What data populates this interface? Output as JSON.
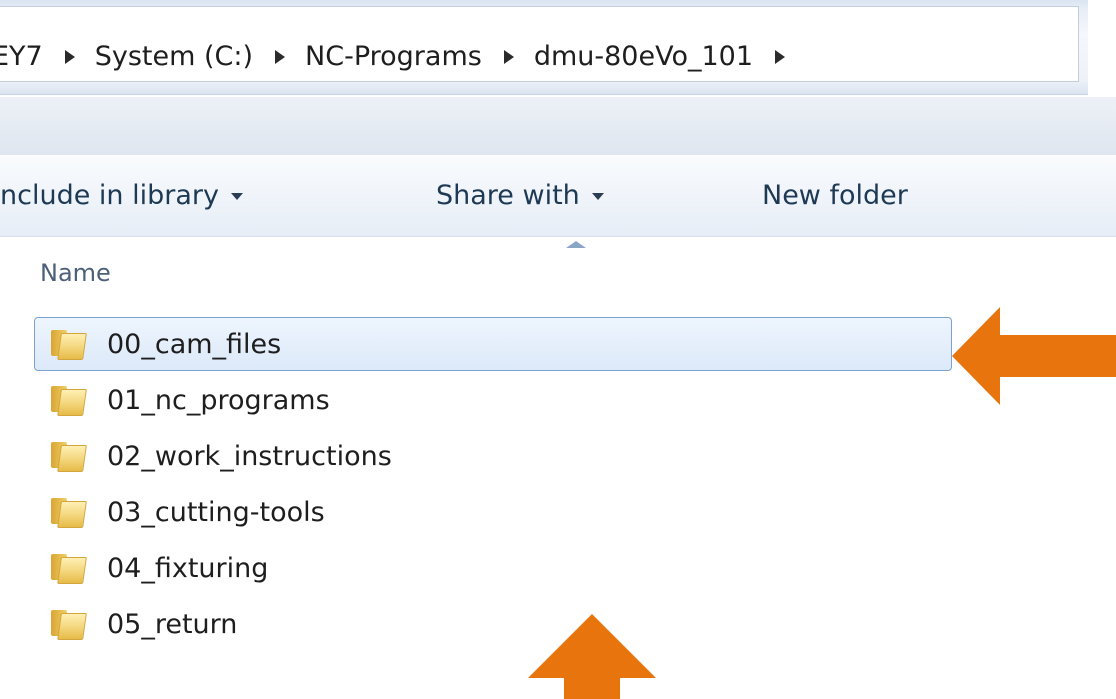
{
  "breadcrumb": {
    "items": [
      "EY7",
      "System (C:)",
      "NC-Programs",
      "dmu-80eVo_101"
    ]
  },
  "toolbar": {
    "include_in_library": "nclude in library",
    "share_with": "Share with",
    "new_folder": "New folder"
  },
  "list_header": {
    "name": "Name"
  },
  "files": [
    {
      "name": "00_cam_files",
      "icon": "folder-icon",
      "selected": true
    },
    {
      "name": "01_nc_programs",
      "icon": "folder-icon",
      "selected": false
    },
    {
      "name": "02_work_instructions",
      "icon": "folder-icon",
      "selected": false
    },
    {
      "name": "03_cutting-tools",
      "icon": "folder-icon",
      "selected": false
    },
    {
      "name": "04_fixturing",
      "icon": "folder-icon",
      "selected": false
    },
    {
      "name": "05_return",
      "icon": "folder-icon",
      "selected": false
    }
  ],
  "colors": {
    "annotation_arrow": "#e8740e",
    "selection_border": "#7da2ce",
    "folder_yellow": "#f3d57b"
  }
}
